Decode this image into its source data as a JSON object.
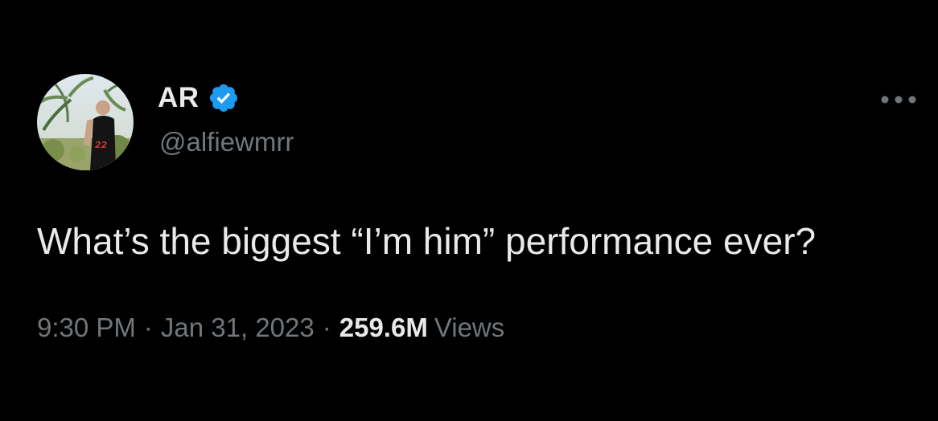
{
  "tweet": {
    "author": {
      "display_name": "AR",
      "handle": "@alfiewmrr",
      "verified": true,
      "avatar_icon": "avatar-photo-icon",
      "verified_icon": "verified-badge-icon"
    },
    "more_icon": "more-options-icon",
    "text": "What’s the biggest “I’m him” performance ever?",
    "time": "9:30 PM",
    "separator": "·",
    "date": "Jan 31, 2023",
    "views_count": "259.6M",
    "views_label": "Views"
  },
  "colors": {
    "background": "#000000",
    "primary_text": "#e7e9ea",
    "secondary_text": "#71767b",
    "verified_blue": "#1d9bf0"
  }
}
